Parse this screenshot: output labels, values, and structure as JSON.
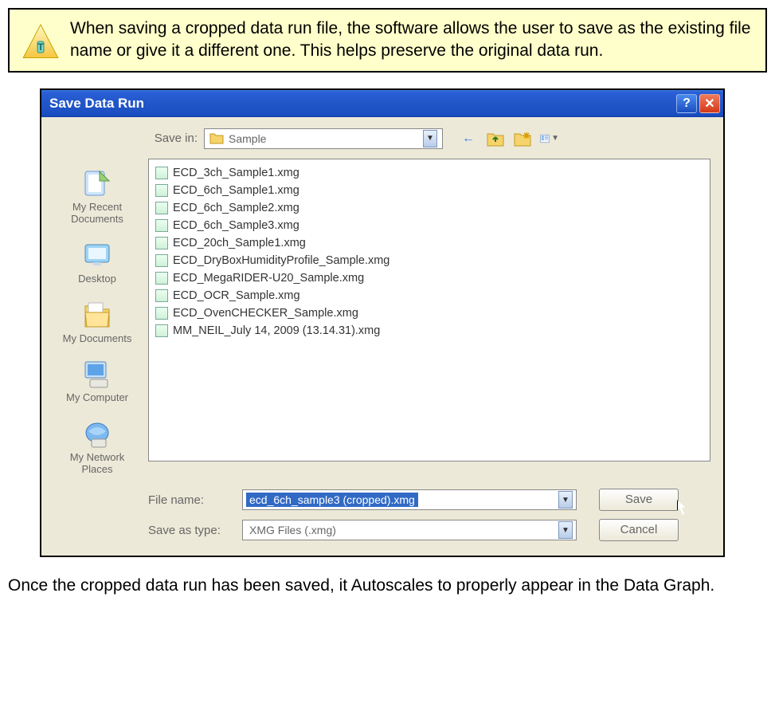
{
  "note": {
    "icon": "tip-triangle-icon",
    "text": "When saving a cropped data run file, the software allows the user to save as the existing file name or give it a different one. This helps preserve the original data run."
  },
  "dialog": {
    "title": "Save Data Run",
    "help_label": "?",
    "close_label": "✕",
    "save_in_label": "Save in:",
    "save_in_folder": "Sample",
    "toolbar": {
      "back": "←",
      "up": "up-icon",
      "new_folder": "new-folder-icon",
      "views": "views-icon"
    },
    "places": [
      {
        "key": "recent",
        "label": "My Recent Documents"
      },
      {
        "key": "desktop",
        "label": "Desktop"
      },
      {
        "key": "mydocs",
        "label": "My Documents"
      },
      {
        "key": "mycomputer",
        "label": "My Computer"
      },
      {
        "key": "network",
        "label": "My Network Places"
      }
    ],
    "files": [
      "ECD_3ch_Sample1.xmg",
      "ECD_6ch_Sample1.xmg",
      "ECD_6ch_Sample2.xmg",
      "ECD_6ch_Sample3.xmg",
      "ECD_20ch_Sample1.xmg",
      "ECD_DryBoxHumidityProfile_Sample.xmg",
      "ECD_MegaRIDER-U20_Sample.xmg",
      "ECD_OCR_Sample.xmg",
      "ECD_OvenCHECKER_Sample.xmg",
      "MM_NEIL_July 14, 2009 (13.14.31).xmg"
    ],
    "file_name_label": "File name:",
    "file_name_value": "ecd_6ch_sample3 (cropped).xmg",
    "save_as_type_label": "Save as type:",
    "save_as_type_value": "XMG Files (.xmg)",
    "save_button": "Save",
    "cancel_button": "Cancel"
  },
  "footer_text": "Once the cropped data run has been saved, it Autoscales to properly appear in the Data Graph."
}
